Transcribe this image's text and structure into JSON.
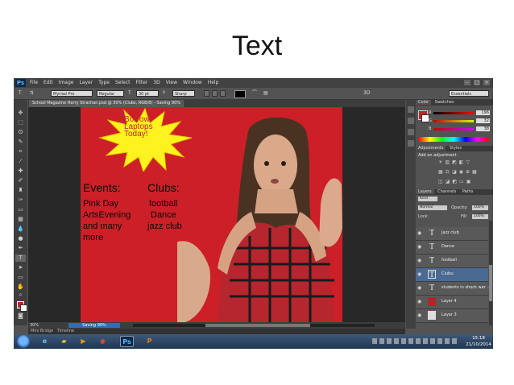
{
  "slide": {
    "title": "Text"
  },
  "app": {
    "logo": "Ps"
  },
  "menu": [
    "File",
    "Edit",
    "Image",
    "Layer",
    "Type",
    "Select",
    "Filter",
    "3D",
    "View",
    "Window",
    "Help"
  ],
  "options_bar": {
    "tool_icon": "T",
    "font_family": "Myriad Pro",
    "font_style": "Regular",
    "font_size": "30 pt",
    "anti_alias": "Sharp",
    "workspace": "Essentials"
  },
  "document": {
    "tab_label": "School Magazine Harry Strachan.psd @ 30% (Clubs, RGB/8) - Saving 90%",
    "zoom": "30%",
    "progress_label": "Saving 90%",
    "progress_fraction": 0.9,
    "star_text": [
      "Borrow",
      "Laptops",
      "Today!"
    ],
    "events_heading": "Events:",
    "events_items": [
      "Pink Day",
      "ArtsEvening",
      "and many",
      "more"
    ],
    "clubs_heading": "Clubs:",
    "clubs_items": [
      "football",
      "Dance",
      "jazz club"
    ]
  },
  "bottom_tabs": [
    "Mini Bridge",
    "Timeline"
  ],
  "color_panel": {
    "tabs": [
      "Color",
      "Swatches"
    ],
    "r_label": "R",
    "g_label": "G",
    "b_label": "B",
    "r": "196",
    "g": "32",
    "b": "38",
    "fg_color": "#c0262a"
  },
  "adjustments_panel": {
    "tabs": [
      "Adjustments",
      "Styles"
    ],
    "title": "Add an adjustment"
  },
  "layers_panel": {
    "tabs": [
      "Layers",
      "Channels",
      "Paths"
    ],
    "kind": "Kind",
    "blend_mode": "Normal",
    "opacity_label": "Opacity:",
    "opacity": "100%",
    "lock_label": "Lock:",
    "fill_label": "Fill:",
    "fill": "100%",
    "layers": [
      {
        "name": "jazz club",
        "type": "text",
        "selected": false
      },
      {
        "name": "Dance",
        "type": "text",
        "selected": false
      },
      {
        "name": "football",
        "type": "text",
        "selected": false
      },
      {
        "name": "Clubs:",
        "type": "text",
        "selected": true
      },
      {
        "name": "students in shock war ...",
        "type": "text",
        "selected": false
      },
      {
        "name": "Layer 4",
        "type": "image",
        "selected": false
      },
      {
        "name": "Layer 3",
        "type": "image",
        "selected": false
      }
    ]
  },
  "taskbar": {
    "time": "15:18",
    "date": "21/10/2014",
    "apps": [
      "ie-icon",
      "folder-icon",
      "media-player-icon",
      "chrome-icon",
      "photoshop-icon",
      "powerpoint-icon"
    ]
  }
}
